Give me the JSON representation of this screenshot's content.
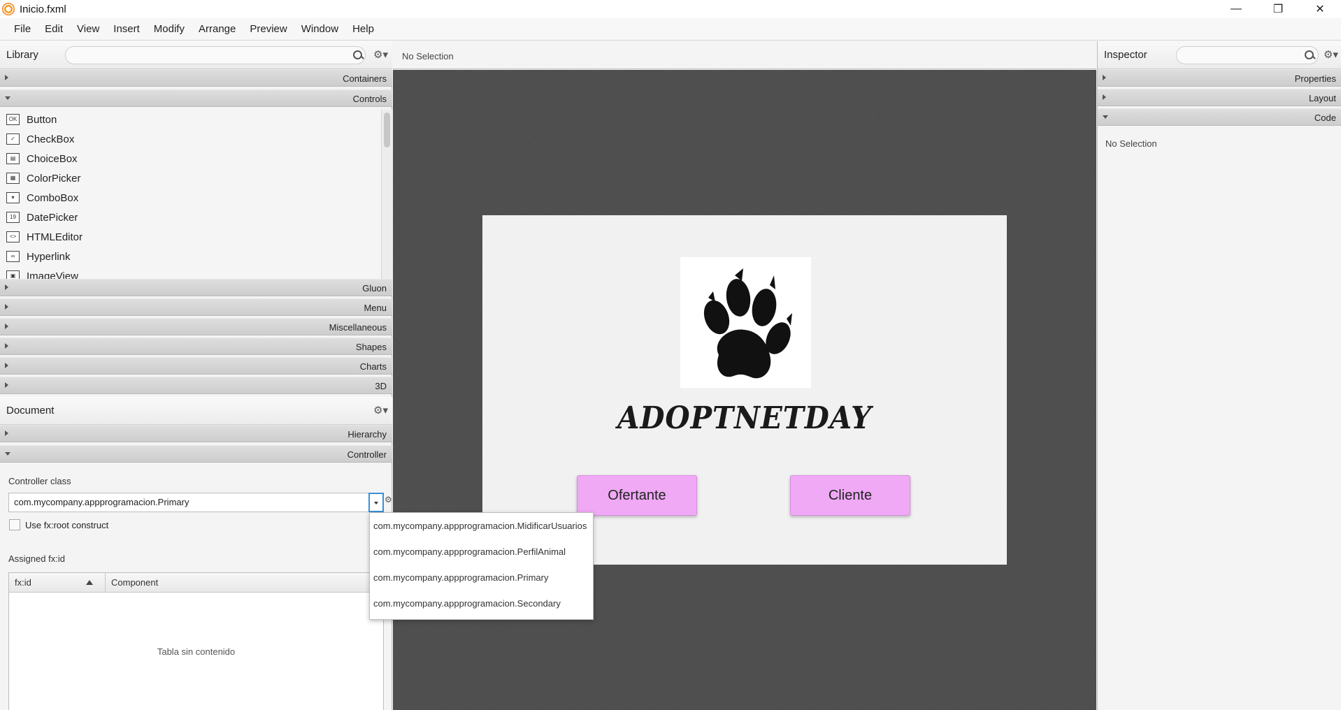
{
  "window": {
    "title": "Inicio.fxml",
    "minimize_glyph": "—",
    "maximize_glyph": "❐",
    "close_glyph": "✕"
  },
  "menu": [
    "File",
    "Edit",
    "View",
    "Insert",
    "Modify",
    "Arrange",
    "Preview",
    "Window",
    "Help"
  ],
  "library": {
    "title": "Library",
    "search_placeholder": "",
    "sections": {
      "containers": "Containers",
      "controls": "Controls",
      "gluon": "Gluon",
      "menu": "Menu",
      "miscellaneous": "Miscellaneous",
      "shapes": "Shapes",
      "charts": "Charts",
      "three_d": "3D"
    },
    "controls": [
      {
        "label": "Button",
        "icon": "button-icon",
        "glyph": "OK"
      },
      {
        "label": "CheckBox",
        "icon": "checkbox-icon",
        "glyph": "✓"
      },
      {
        "label": "ChoiceBox",
        "icon": "choicebox-icon",
        "glyph": "▤"
      },
      {
        "label": "ColorPicker",
        "icon": "colorpicker-icon",
        "glyph": "▦"
      },
      {
        "label": "ComboBox",
        "icon": "combobox-icon",
        "glyph": "▾"
      },
      {
        "label": "DatePicker",
        "icon": "datepicker-icon",
        "glyph": "19"
      },
      {
        "label": "HTMLEditor",
        "icon": "htmleditor-icon",
        "glyph": "<>"
      },
      {
        "label": "Hyperlink",
        "icon": "hyperlink-icon",
        "glyph": "∞"
      },
      {
        "label": "ImageView",
        "icon": "imageview-icon",
        "glyph": "▣"
      }
    ]
  },
  "document": {
    "title": "Document",
    "sections": {
      "hierarchy": "Hierarchy",
      "controller": "Controller"
    },
    "controller_class_label": "Controller class",
    "controller_class_value": "com.mycompany.appprogramacion.Primary",
    "use_root_label": "Use fx:root construct",
    "assigned_label": "Assigned fx:id",
    "table": {
      "columns": [
        "fx:id",
        "Component"
      ],
      "empty_text": "Tabla sin contenido"
    },
    "dropdown_options": [
      "com.mycompany.appprogramacion.MidificarUsuarios",
      "com.mycompany.appprogramacion.PerfilAnimal",
      "com.mycompany.appprogramacion.Primary",
      "com.mycompany.appprogramacion.Secondary"
    ]
  },
  "canvas": {
    "selection_text": "No Selection",
    "app_name": "ADOPTNETDAY",
    "buttons": {
      "ofertante": "Ofertante",
      "cliente": "Cliente"
    },
    "button_color": "#f0a9f5"
  },
  "inspector": {
    "title": "Inspector",
    "sections": {
      "properties": "Properties",
      "layout": "Layout",
      "code": "Code"
    },
    "no_selection": "No Selection"
  }
}
